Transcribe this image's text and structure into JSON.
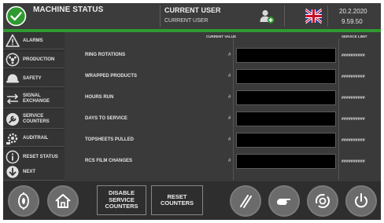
{
  "header": {
    "title": "MACHINE STATUS",
    "user_title": "CURRENT USER",
    "user_name": "CURRENT USER",
    "date": "20.2.2020",
    "time": "9.59.50",
    "accent_color": "#2f9a31"
  },
  "sidebar": {
    "items": [
      {
        "label": "ALARMS",
        "icon": "warning-icon"
      },
      {
        "label": "PRODUCTION",
        "icon": "production-icon"
      },
      {
        "label": "SAFETY",
        "icon": "helmet-icon"
      },
      {
        "label": "SIGNAL\nEXCHANGE",
        "icon": "signal-exchange-icon"
      },
      {
        "label": "SERVICE\nCOUNTERS",
        "icon": "wrench-icon"
      },
      {
        "label": "AUDITRAIL",
        "icon": "audit-icon"
      },
      {
        "label": "RESET STATUS",
        "icon": "info-icon"
      },
      {
        "label": "NEXT",
        "icon": "arrow-down-icon"
      }
    ]
  },
  "main": {
    "current_value_header": "CURRENT VALUE",
    "service_limit_header": "SERVICE LIMIT",
    "rows": [
      {
        "label": "RING ROTATIONS",
        "hash": "#",
        "limit": "##########"
      },
      {
        "label": "WRAPPED PRODUCTS",
        "hash": "#",
        "limit": "##########"
      },
      {
        "label": "HOURS RUN",
        "hash": "#",
        "limit": "##########"
      },
      {
        "label": "DAYS TO SERVICE",
        "hash": "#",
        "limit": "##########"
      },
      {
        "label": "TOPSHEETS PULLED",
        "hash": "#",
        "limit": "##########"
      },
      {
        "label": "RCS FILM CHANGES",
        "hash": "#",
        "limit": "##########"
      }
    ]
  },
  "footer": {
    "disable_label": "DISABLE\nSERVICE\nCOUNTERS",
    "reset_label": "RESET\nCOUNTERS"
  }
}
